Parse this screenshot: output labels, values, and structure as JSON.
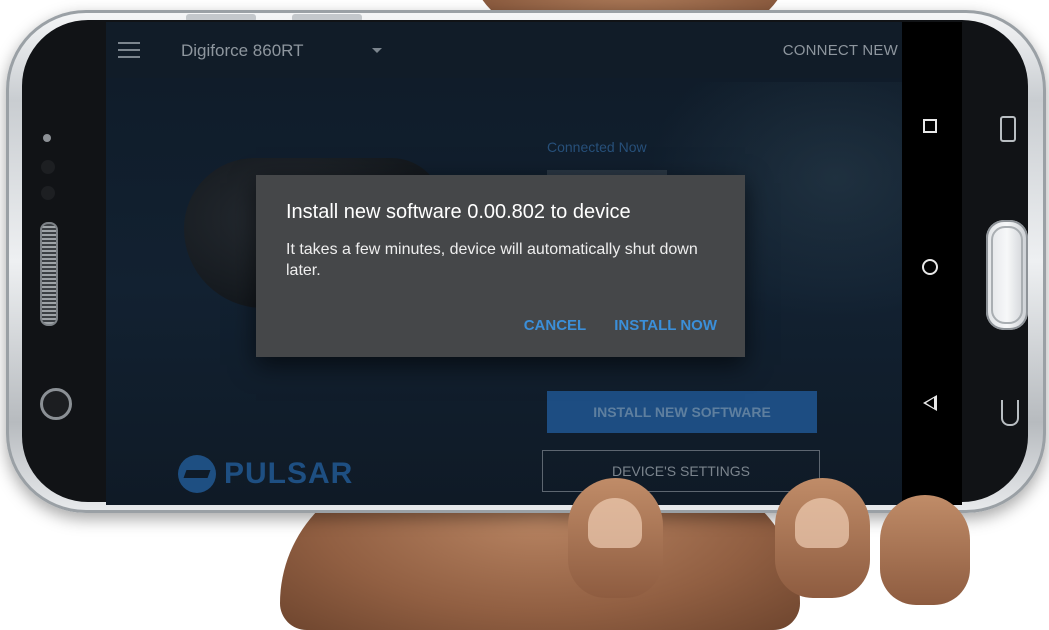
{
  "app": {
    "device_name": "Digiforce 860RT",
    "connect_new_label": "CONNECT NEW"
  },
  "main": {
    "connected_status": "Connected Now",
    "install_button_label": "INSTALL NEW SOFTWARE",
    "settings_button_label": "DEVICE'S SETTINGS",
    "logo_text": "PULSAR"
  },
  "dialog": {
    "title": "Install new software 0.00.802 to device",
    "body": "It takes a few minutes, device will automatically shut down later.",
    "cancel_label": "CANCEL",
    "confirm_label": "INSTALL NOW"
  },
  "colors": {
    "accent": "#3b8fd9",
    "primary_button": "#1d4d82",
    "dialog_bg": "#454749"
  },
  "icons": {
    "menu": "menu-icon",
    "dropdown": "chevron-down-icon",
    "recents": "recents-icon",
    "home": "home-icon",
    "back": "back-icon"
  }
}
